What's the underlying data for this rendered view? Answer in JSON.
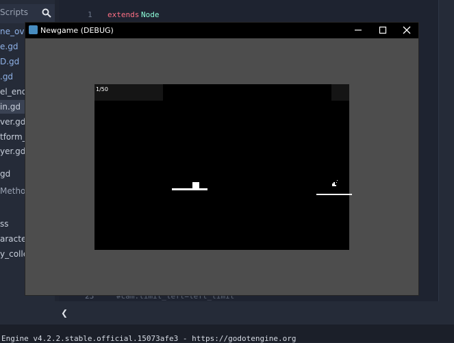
{
  "editor": {
    "sidebar_title": "Scripts",
    "scripts": [
      "ne_ove",
      "e.gd",
      "D.gd",
      ".gd",
      "el_end.",
      "in.gd",
      "ver.gd",
      "tform_",
      "yer.gd"
    ],
    "selected_index": 5,
    "lower_items": [
      "gd"
    ],
    "method_label": "Method",
    "class_items": [
      "ss",
      "aracter",
      "y_colle"
    ],
    "code": {
      "line1_num": "1",
      "line1_kw": "extends",
      "line1_type": "Node",
      "line23_num": "23",
      "line23_text": "#cam.limit_left=left_limit"
    },
    "collapse_glyph": "❮",
    "status_text": "Engine v4.2.2.stable.official.15073afe3 - https://godotengine.org"
  },
  "game_window": {
    "title": "Newgame (DEBUG)",
    "counter": "1/50",
    "colors": {
      "viewport_bg": "#000000",
      "window_bg": "#4d4d4d",
      "titlebar": "#000000"
    }
  }
}
